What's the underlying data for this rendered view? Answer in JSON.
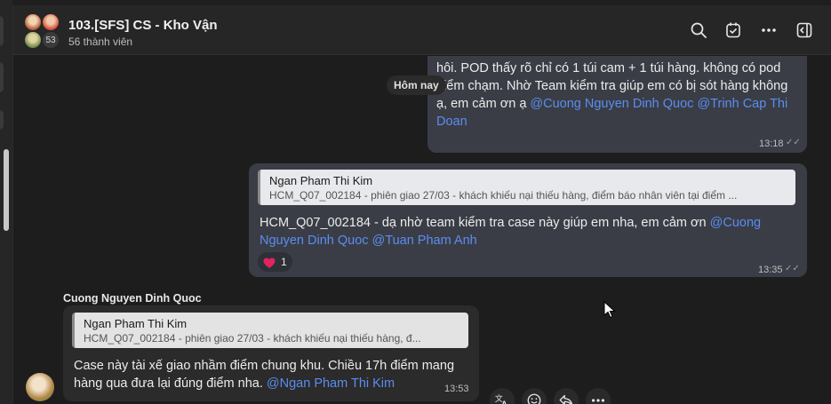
{
  "header": {
    "title": "103.[SFS] CS - Kho Vận",
    "members": "56 thành viên",
    "avatar_count": "53"
  },
  "date_separator": "Hôm nay",
  "messages": [
    {
      "id": "m1",
      "text_plain": "hôi. POD thấy rõ chỉ có 1 túi cam + 1 túi hàng. không có pod điểm chạm. Nhờ Team kiểm tra giúp em có bị sót hàng không ạ, em cảm ơn ạ",
      "line1": "hôi. POD thấy rõ chỉ có 1 túi cam + 1 túi hàng. không có pod",
      "line2": "điểm chạm. Nhờ Team kiểm tra giúp em có bị sót hàng không",
      "line3": "ạ, em cảm ơn ạ ",
      "mention1": "@Cuong Nguyen Dinh Quoc",
      "mention2": "@Trinh Cap Thi",
      "line4_mention": "Doan",
      "time": "13:18"
    },
    {
      "id": "m2",
      "quote_name": "Ngan Pham Thi Kim",
      "quote_text": "HCM_Q07_002184 - phiên giao 27/03 - khách khiếu nại thiếu hàng, điểm báo nhân viên tại điểm ...",
      "line1": "HCM_Q07_002184 - dạ nhờ team kiểm tra case này giúp em nha, em cảm ơn ",
      "mention1": "@Cuong",
      "mention2": "Nguyen Dinh Quoc",
      "mention3": "@Tuan Pham Anh",
      "reaction_emoji": "❤️",
      "reaction_count": "1",
      "time": "13:35"
    },
    {
      "id": "m3",
      "sender": "Cuong Nguyen Dinh Quoc",
      "quote_name": "Ngan Pham Thi Kim",
      "quote_text": "HCM_Q07_002184 - phiên giao 27/03 - khách khiếu nại thiếu hàng, đ...",
      "line1": "Case này tài xế giao nhầm điểm chung khu. Chiều 17h điểm mang",
      "line2": "hàng qua đưa lại đúng điểm nha. ",
      "mention1": "@Ngan Pham Thi Kim",
      "time": "13:53"
    }
  ],
  "icons": {
    "header": [
      "search-icon",
      "task-icon",
      "more-icon",
      "sidebar-toggle-icon"
    ],
    "actions": [
      "translate-icon",
      "emoji-icon",
      "reply-icon",
      "more-icon"
    ]
  },
  "colors": {
    "mention": "#5b8def",
    "outgoing_bubble": "#3a3d46",
    "incoming_bubble": "#2b2b2b",
    "reaction_heart": "#e0245e"
  }
}
